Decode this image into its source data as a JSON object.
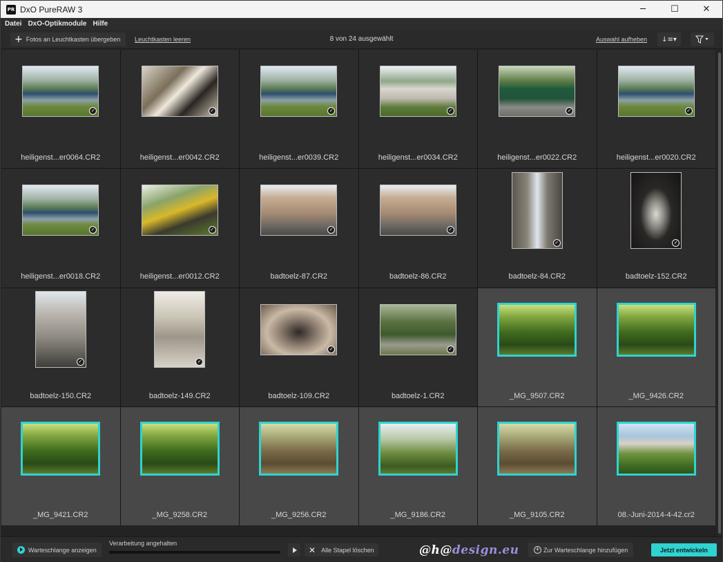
{
  "window": {
    "app_icon": "PR",
    "title": "DxO PureRAW 3",
    "minimize": "─",
    "maximize": "☐",
    "close": "✕"
  },
  "menu": [
    "Datei",
    "DxO-Optikmodule",
    "Hilfe"
  ],
  "toolbar": {
    "add_label": "Fotos an Leuchtkasten übergeben",
    "clear_label": "Leuchtkasten leeren",
    "status": "8 von 24 ausgewählt",
    "deselect_label": "Auswahl aufheben",
    "sort_icon": "sort-icon",
    "filter_icon": "filter-icon"
  },
  "colors": {
    "accent": "#2fd3d0",
    "background": "#2c2c2c",
    "selected_cell": "#484848"
  },
  "photos": [
    {
      "name": "heiligenst...er0064.CR2",
      "orientation": "land",
      "selected": false,
      "scene": "car"
    },
    {
      "name": "heiligenst...er0042.CR2",
      "orientation": "land",
      "selected": false,
      "scene": "interior"
    },
    {
      "name": "heiligenst...er0039.CR2",
      "orientation": "land",
      "selected": false,
      "scene": "car"
    },
    {
      "name": "heiligenst...er0034.CR2",
      "orientation": "land",
      "selected": false,
      "scene": "van"
    },
    {
      "name": "heiligenst...er0022.CR2",
      "orientation": "land",
      "selected": false,
      "scene": "greenvan"
    },
    {
      "name": "heiligenst...er0020.CR2",
      "orientation": "land",
      "selected": false,
      "scene": "car"
    },
    {
      "name": "heiligenst...er0018.CR2",
      "orientation": "land",
      "selected": false,
      "scene": "car"
    },
    {
      "name": "heiligenst...er0012.CR2",
      "orientation": "land",
      "selected": false,
      "scene": "yellowcar"
    },
    {
      "name": "badtoelz-87.CR2",
      "orientation": "land",
      "selected": false,
      "scene": "street"
    },
    {
      "name": "badtoelz-86.CR2",
      "orientation": "land",
      "selected": false,
      "scene": "street"
    },
    {
      "name": "badtoelz-84.CR2",
      "orientation": "port",
      "selected": false,
      "scene": "alley"
    },
    {
      "name": "badtoelz-152.CR2",
      "orientation": "port",
      "selected": false,
      "scene": "arch"
    },
    {
      "name": "badtoelz-150.CR2",
      "orientation": "port",
      "selected": false,
      "scene": "house"
    },
    {
      "name": "badtoelz-149.CR2",
      "orientation": "port",
      "selected": false,
      "scene": "arcade"
    },
    {
      "name": "badtoelz-109.CR2",
      "orientation": "land",
      "selected": false,
      "scene": "pano"
    },
    {
      "name": "badtoelz-1.CR2",
      "orientation": "land",
      "selected": false,
      "scene": "garden"
    },
    {
      "name": "_MG_9507.CR2",
      "orientation": "land",
      "selected": true,
      "scene": "forest"
    },
    {
      "name": "_MG_9426.CR2",
      "orientation": "land",
      "selected": true,
      "scene": "forest"
    },
    {
      "name": "_MG_9421.CR2",
      "orientation": "land",
      "selected": true,
      "scene": "forest"
    },
    {
      "name": "_MG_9258.CR2",
      "orientation": "land",
      "selected": true,
      "scene": "forest"
    },
    {
      "name": "_MG_9256.CR2",
      "orientation": "land",
      "selected": true,
      "scene": "forestbrown"
    },
    {
      "name": "_MG_9186.CR2",
      "orientation": "land",
      "selected": true,
      "scene": "forestsky"
    },
    {
      "name": "_MG_9105.CR2",
      "orientation": "land",
      "selected": true,
      "scene": "forestbrown"
    },
    {
      "name": "08.-Juni-2014-4-42.cr2",
      "orientation": "land",
      "selected": true,
      "scene": "rock"
    }
  ],
  "bottom": {
    "queue_label": "Warteschlange anzeigen",
    "processing_label": "Verarbeitung angehalten",
    "progress_fraction": 0,
    "clear_stacks_label": "Alle Stapel löschen",
    "clear_icon": "✕",
    "watermark_a": "@h@",
    "watermark_b": "design.eu",
    "add_queue_label": "Zur Warteschlange hinzufügen",
    "develop_label": "Jetzt entwickeln"
  }
}
